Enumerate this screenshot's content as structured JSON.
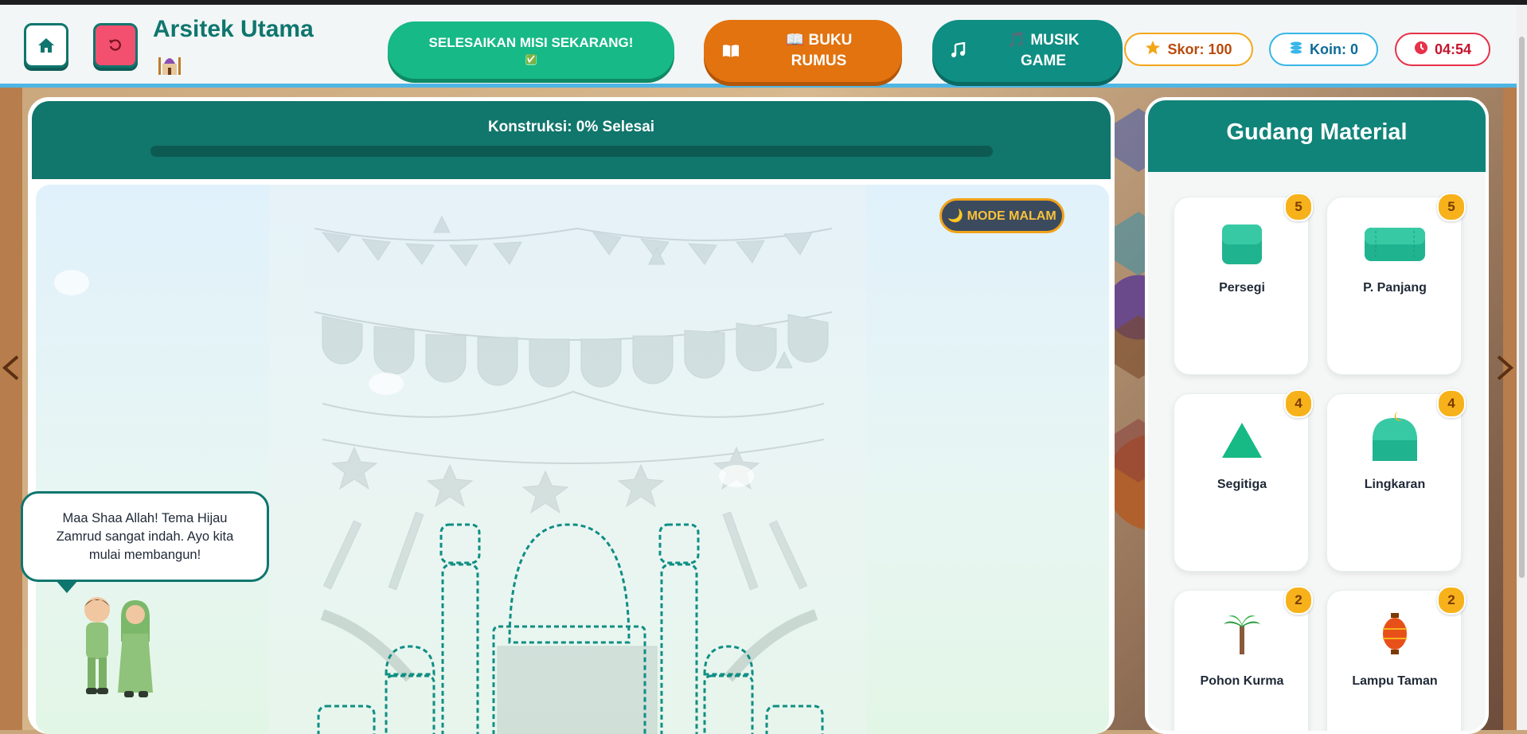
{
  "header": {
    "title": "Arsitek Utama",
    "title_emoji": "🕌",
    "home_icon": "home-icon",
    "reset_icon": "reset-icon",
    "mission_label": "SELESAIKAN MISI SEKARANG!",
    "mission_check": "✅",
    "buku_label": "📖 BUKU RUMUS",
    "musik_label": "🎵 MUSIK GAME",
    "score_label": "Skor:",
    "score_value": "100",
    "coin_label": "Koin:",
    "coin_value": "0",
    "timer_value": "04:54"
  },
  "construction": {
    "progress_label": "Konstruksi: 0% Selesai",
    "progress_percent": 0,
    "night_mode_label": "🌙 MODE MALAM",
    "speech_text": "Maa Shaa Allah! Tema Hijau Zamrud sangat indah. Ayo kita mulai membangun!"
  },
  "warehouse": {
    "title": "Gudang Material",
    "items": [
      {
        "name": "Persegi",
        "count": "5",
        "icon": "square-icon"
      },
      {
        "name": "P. Panjang",
        "count": "5",
        "icon": "rectangle-icon"
      },
      {
        "name": "Segitiga",
        "count": "4",
        "icon": "triangle-icon"
      },
      {
        "name": "Lingkaran",
        "count": "4",
        "icon": "dome-icon"
      },
      {
        "name": "Pohon Kurma",
        "count": "2",
        "icon": "palm-tree-icon"
      },
      {
        "name": "Lampu Taman",
        "count": "2",
        "icon": "lantern-icon"
      }
    ]
  },
  "colors": {
    "primary": "#0f766e",
    "mission": "#17b986",
    "buku": "#e2730f",
    "musik": "#0f8e83",
    "badge": "#f7b21b"
  }
}
